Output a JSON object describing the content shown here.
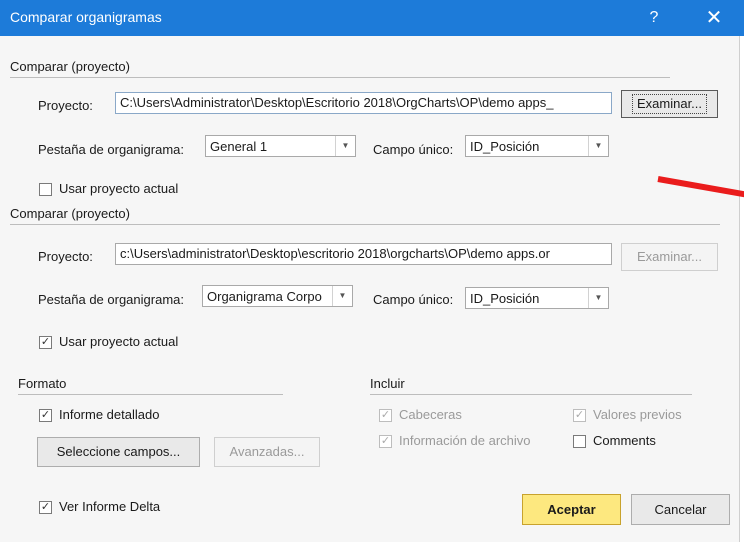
{
  "window": {
    "title": "Comparar organigramas",
    "help": "?",
    "close": "✕"
  },
  "compare1": {
    "section": "Comparar (proyecto)",
    "project_label": "Proyecto:",
    "project_path": "C:\\Users\\Administrator\\Desktop\\Escritorio 2018\\OrgCharts\\OP\\demo apps_",
    "browse": "Examinar...",
    "tab_label": "Pestaña de organigrama:",
    "tab_value": "General 1",
    "field_label": "Campo único:",
    "field_value": "ID_Posición",
    "use_current": "Usar proyecto actual",
    "use_current_checked": false
  },
  "compare2": {
    "section": "Comparar (proyecto)",
    "project_label": "Proyecto:",
    "project_path": "c:\\Users\\administrator\\Desktop\\escritorio 2018\\orgcharts\\OP\\demo apps.or",
    "browse": "Examinar...",
    "tab_label": "Pestaña de organigrama:",
    "tab_value": "Organigrama Corpo",
    "field_label": "Campo único:",
    "field_value": "ID_Posición",
    "use_current": "Usar proyecto actual",
    "use_current_checked": true
  },
  "format": {
    "section": "Formato",
    "detailed": "Informe detallado",
    "select_fields": "Seleccione campos...",
    "advanced": "Avanzadas...",
    "delta": "Ver Informe Delta"
  },
  "include": {
    "section": "Incluir",
    "headers": "Cabeceras",
    "prev_values": "Valores previos",
    "file_info": "Información de archivo",
    "comments": "Comments"
  },
  "buttons": {
    "accept": "Aceptar",
    "cancel": "Cancelar"
  },
  "glyphs": {
    "check": "✓",
    "dropdown": "▼"
  },
  "colors": {
    "titlebar": "#1d7bd9",
    "accept": "#fde87f",
    "annotation": "#ea1c1c"
  }
}
